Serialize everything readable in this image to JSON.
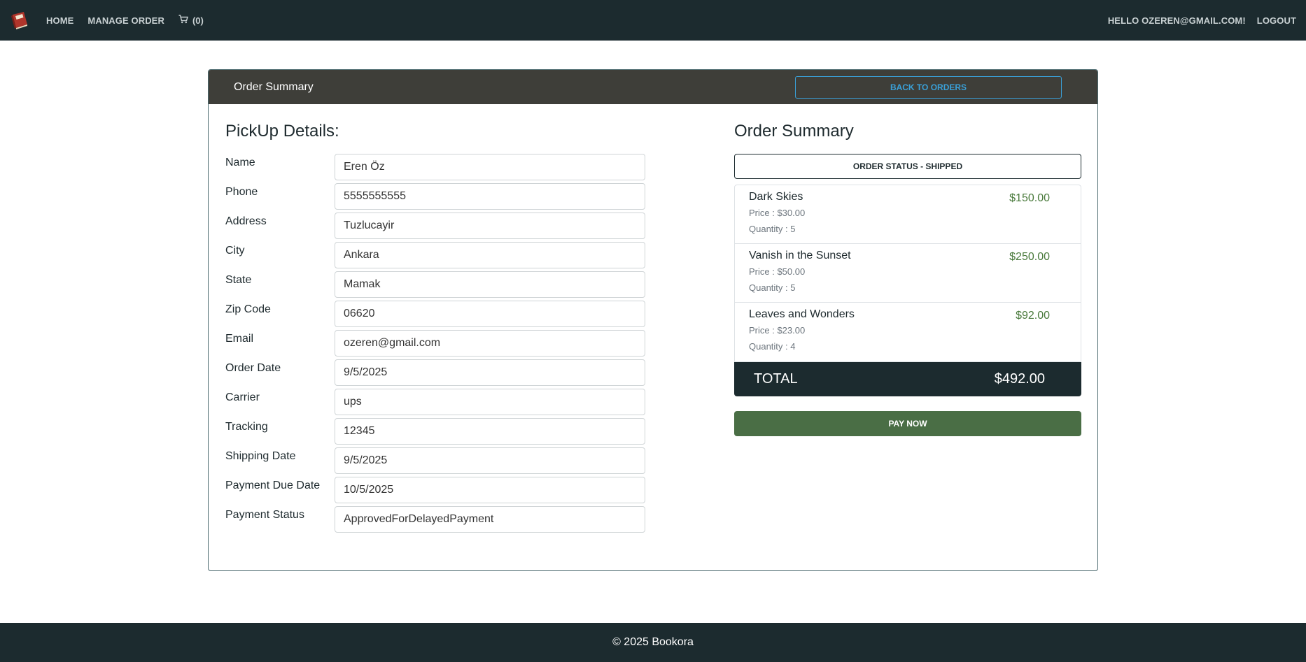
{
  "nav": {
    "home": "HOME",
    "manage_order": "MANAGE ORDER",
    "cart_count": "(0)",
    "greeting": "HELLO OZEREN@GMAIL.COM!",
    "logout": "LOGOUT"
  },
  "card": {
    "header_title": "Order Summary",
    "back_label": "BACK TO ORDERS"
  },
  "pickup": {
    "title": "PickUp Details:",
    "fields": [
      {
        "label": "Name",
        "value": "Eren Öz"
      },
      {
        "label": "Phone",
        "value": "5555555555"
      },
      {
        "label": "Address",
        "value": "Tuzlucayir"
      },
      {
        "label": "City",
        "value": "Ankara"
      },
      {
        "label": "State",
        "value": "Mamak"
      },
      {
        "label": "Zip Code",
        "value": "06620"
      },
      {
        "label": "Email",
        "value": "ozeren@gmail.com"
      },
      {
        "label": "Order Date",
        "value": "9/5/2025"
      },
      {
        "label": "Carrier",
        "value": "ups"
      },
      {
        "label": "Tracking",
        "value": "12345"
      },
      {
        "label": "Shipping Date",
        "value": "9/5/2025"
      },
      {
        "label": "Payment Due Date",
        "value": "10/5/2025"
      },
      {
        "label": "Payment Status",
        "value": "ApprovedForDelayedPayment"
      }
    ]
  },
  "summary": {
    "title": "Order Summary",
    "status": "ORDER STATUS - SHIPPED",
    "items": [
      {
        "name": "Dark Skies",
        "total": "$150.00",
        "price": "Price : $30.00",
        "quantity": "Quantity : 5"
      },
      {
        "name": "Vanish in the Sunset",
        "total": "$250.00",
        "price": "Price : $50.00",
        "quantity": "Quantity : 5"
      },
      {
        "name": "Leaves and Wonders",
        "total": "$92.00",
        "price": "Price : $23.00",
        "quantity": "Quantity : 4"
      }
    ],
    "total_label": "TOTAL",
    "total_amount": "$492.00",
    "pay_label": "PAY NOW"
  },
  "footer": {
    "text": "© 2025 Bookora"
  },
  "colors": {
    "navbar": "#1c2b2f",
    "header": "#3e3e39",
    "accent_blue": "#3aa0d8",
    "price_green": "#4a7a3c",
    "pay_green": "#4a6e45"
  },
  "icons": {
    "logo": "book-logo-icon",
    "cart": "cart-icon"
  }
}
